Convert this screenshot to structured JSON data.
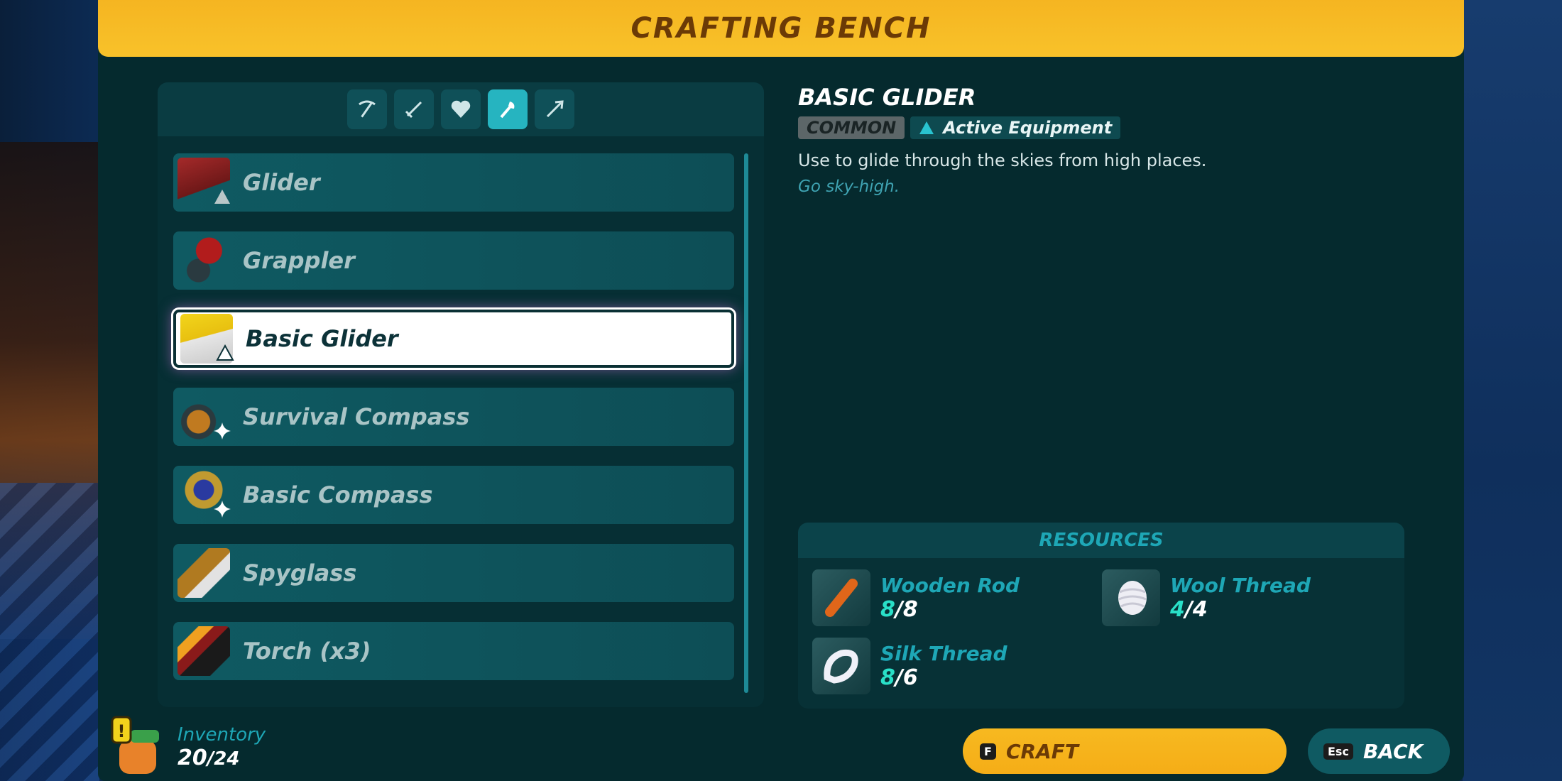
{
  "header": {
    "title": "CRAFTING BENCH"
  },
  "categories": [
    {
      "icon": "pickaxe-icon",
      "active": false
    },
    {
      "icon": "sword-icon",
      "active": false
    },
    {
      "icon": "heart-icon",
      "active": false
    },
    {
      "icon": "torch-icon",
      "active": true
    },
    {
      "icon": "arrow-icon",
      "active": false
    }
  ],
  "items": [
    {
      "label": "Glider",
      "badge": "triangle-icon",
      "selected": false
    },
    {
      "label": "Grappler",
      "badge": "",
      "selected": false
    },
    {
      "label": "Basic Glider",
      "badge": "triangle-icon",
      "selected": true
    },
    {
      "label": "Survival Compass",
      "badge": "sparkle-icon",
      "selected": false
    },
    {
      "label": "Basic Compass",
      "badge": "sparkle-icon",
      "selected": false
    },
    {
      "label": "Spyglass",
      "badge": "",
      "selected": false
    },
    {
      "label": "Torch (x3)",
      "badge": "",
      "selected": false
    }
  ],
  "detail": {
    "title": "BASIC GLIDER",
    "rarity": "COMMON",
    "type": "Active Equipment",
    "description": "Use to glide through the skies from high places.",
    "flavor": "Go sky-high."
  },
  "resources": {
    "title": "RESOURCES",
    "items": [
      {
        "name": "Wooden Rod",
        "have": "8",
        "need": "/8",
        "icon": "wooden-rod-icon"
      },
      {
        "name": "Wool Thread",
        "have": "4",
        "need": "/4",
        "icon": "wool-thread-icon"
      },
      {
        "name": "Silk Thread",
        "have": "8",
        "need": "/6",
        "icon": "silk-thread-icon"
      }
    ]
  },
  "inventory": {
    "label": "Inventory",
    "count": "20",
    "max": "/24"
  },
  "buttons": {
    "craft_key": "F",
    "craft_label": "CRAFT",
    "back_key": "Esc",
    "back_label": "BACK"
  },
  "colors": {
    "accent": "#f5b521",
    "panel": "#052a2e",
    "teal": "#1ea7b6",
    "have": "#29e0c8"
  }
}
